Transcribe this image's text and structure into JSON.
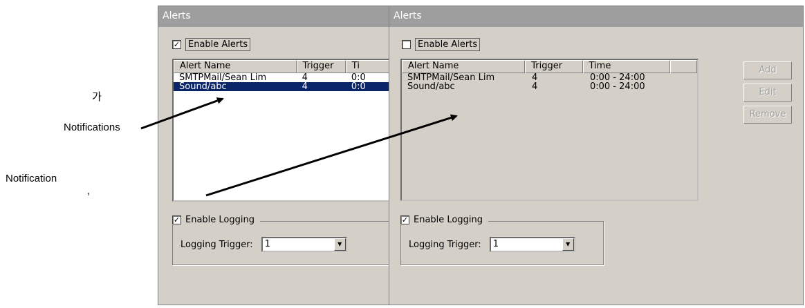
{
  "annotations": {
    "ga": "가",
    "notifications": "Notifications",
    "notification": "Notification",
    "comma": ","
  },
  "left_dialog": {
    "title": "Alerts",
    "enable_alerts": {
      "label": "Enable Alerts",
      "checked": true
    },
    "list": {
      "columns": [
        "Alert Name",
        "Trigger",
        "Ti"
      ],
      "rows": [
        {
          "name": "SMTPMail/Sean Lim",
          "trigger": "4",
          "time": "0:0",
          "selected": false
        },
        {
          "name": "Sound/abc",
          "trigger": "4",
          "time": "0:0",
          "selected": true
        }
      ]
    },
    "enable_logging": {
      "label": "Enable Logging",
      "checked": true
    },
    "logging_trigger": {
      "label": "Logging Trigger:",
      "value": "1"
    }
  },
  "right_dialog": {
    "title": "Alerts",
    "enable_alerts": {
      "label": "Enable Alerts",
      "checked": false
    },
    "list": {
      "columns": [
        "Alert Name",
        "Trigger",
        "Time",
        ""
      ],
      "rows": [
        {
          "name": "SMTPMail/Sean Lim",
          "trigger": "4",
          "time": "0:00 - 24:00"
        },
        {
          "name": "Sound/abc",
          "trigger": "4",
          "time": "0:00 - 24:00"
        }
      ]
    },
    "buttons": {
      "add": "Add",
      "edit": "Edit",
      "remove": "Remove"
    },
    "enable_logging": {
      "label": "Enable Logging",
      "checked": true
    },
    "logging_trigger": {
      "label": "Logging Trigger:",
      "value": "1"
    }
  },
  "colors": {
    "selection": "#0a246a",
    "titlebar": "#9e9e9e",
    "dialog_bg": "#d4d0c8"
  }
}
